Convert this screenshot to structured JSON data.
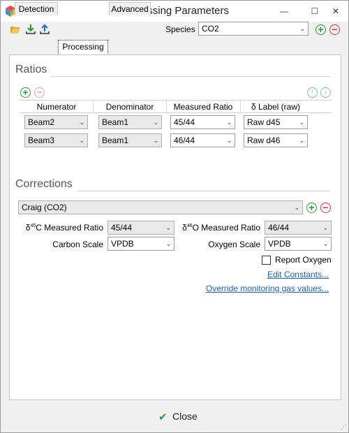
{
  "window": {
    "title": "Processing Parameters",
    "minimize": "—",
    "maximize": "☐",
    "close": "✕"
  },
  "toolbar": {
    "species_label": "Species",
    "species_value": "CO2"
  },
  "tabs": [
    {
      "label": "Detection",
      "active": false
    },
    {
      "label": "Processing",
      "active": true
    },
    {
      "label": "Advanced",
      "active": false
    }
  ],
  "ratios": {
    "title": "Ratios",
    "columns": [
      "Numerator",
      "Denominator",
      "Measured Ratio",
      "δ Label (raw)"
    ],
    "rows": [
      {
        "numerator": "Beam2",
        "denominator": "Beam1",
        "measured_ratio": "45/44",
        "delta_label": "Raw d45"
      },
      {
        "numerator": "Beam3",
        "denominator": "Beam1",
        "measured_ratio": "46/44",
        "delta_label": "Raw d46"
      }
    ]
  },
  "corrections": {
    "title": "Corrections",
    "method": "Craig (CO2)",
    "c13_label_pre": "δ",
    "c13_sup": "45",
    "c13_label_post": "C Measured Ratio",
    "c13_value": "45/44",
    "o18_label_pre": "δ",
    "o18_sup": "46",
    "o18_label_post": "O Measured Ratio",
    "o18_value": "46/44",
    "carbon_scale_label": "Carbon Scale",
    "carbon_scale_value": "VPDB",
    "oxygen_scale_label": "Oxygen Scale",
    "oxygen_scale_value": "VPDB",
    "report_oxygen_label": "Report Oxygen",
    "report_oxygen_checked": false,
    "edit_constants_link": "Edit Constants...",
    "override_link": "Override monitoring gas values..."
  },
  "footer": {
    "close_label": "Close"
  },
  "icons": {
    "add": "+",
    "remove": "−",
    "up": "↑",
    "down": "↓",
    "dropdown": "⌄",
    "check": "✔"
  },
  "colors": {
    "add": "#2e9a2e",
    "remove": "#d33333",
    "link": "#1a5fb4",
    "move": "#7fb0e8"
  }
}
